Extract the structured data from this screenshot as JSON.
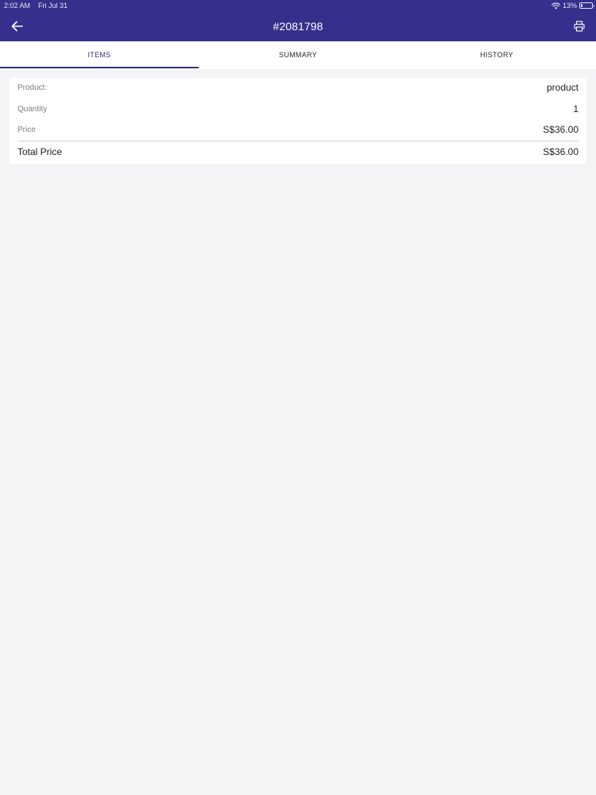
{
  "status_bar": {
    "time": "2:02 AM",
    "date": "Fri Jul 31",
    "battery": "13%",
    "battery_level": 0.13,
    "wifi_icon": "wifi-icon",
    "battery_icon": "battery-icon"
  },
  "nav_bar": {
    "title": "#2081798",
    "back_icon": "arrow-left-icon",
    "print_icon": "printer-icon"
  },
  "tabs": [
    {
      "label": "ITEMS",
      "active": true
    },
    {
      "label": "SUMMARY",
      "active": false
    },
    {
      "label": "HISTORY",
      "active": false
    }
  ],
  "items": {
    "product": {
      "label": "Product:",
      "value": "product"
    },
    "quantity": {
      "label": "Quantity",
      "value": "1"
    },
    "price": {
      "label": "Price",
      "value": "S$36.00"
    },
    "total": {
      "label": "Total Price",
      "value": "S$36.00"
    }
  },
  "colors": {
    "header_bg": "#35308c",
    "page_bg": "#f4f4f6",
    "card_bg": "#ffffff",
    "active_tab": "#35308c"
  }
}
